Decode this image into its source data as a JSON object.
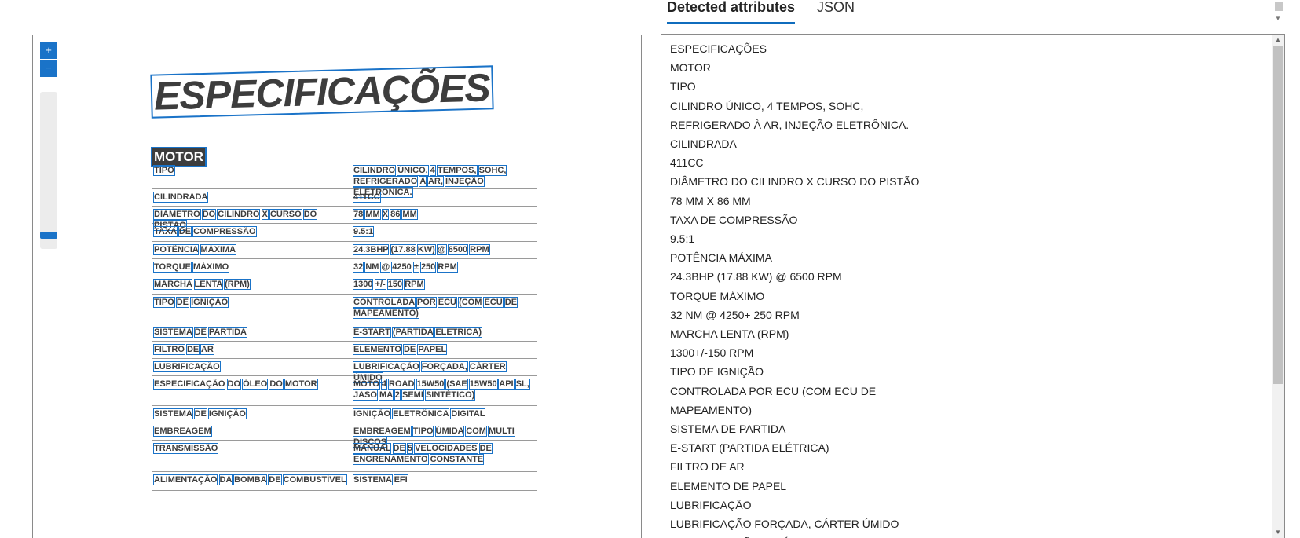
{
  "tabs": [
    {
      "label": "Detected attributes",
      "active": true
    },
    {
      "label": "JSON",
      "active": false
    }
  ],
  "viewer": {
    "zoom_in_icon": "plus-icon",
    "zoom_out_icon": "minus-icon",
    "zoom_in_label": "+",
    "zoom_out_label": "−"
  },
  "document": {
    "title": "ESPECIFICAÇÕES",
    "section": "MOTOR",
    "rows": [
      {
        "label": "TIPO",
        "value": "CILINDRO ÚNICO, 4 TEMPOS, SOHC, REFRIGERADO À AR, INJEÇÃO ELETRÔNICA."
      },
      {
        "label": "CILINDRADA",
        "value": "411CC"
      },
      {
        "label": "DIÂMETRO DO CILINDRO X CURSO DO PISTÃO",
        "value": "78 MM X 86 MM"
      },
      {
        "label": "TAXA DE COMPRESSÃO",
        "value": "9.5:1"
      },
      {
        "label": "POTÊNCIA MÁXIMA",
        "value": "24.3BHP (17.88 KW) @ 6500 RPM"
      },
      {
        "label": "TORQUE MÁXIMO",
        "value": "32 NM @ 4250 ± 250 RPM"
      },
      {
        "label": "MARCHA LENTA (RPM)",
        "value": "1300 +/- 150 RPM"
      },
      {
        "label": "TIPO DE IGNIÇÃO",
        "value": "CONTROLADA POR ECU (COM ECU DE MAPEAMENTO)"
      },
      {
        "label": "SISTEMA DE PARTIDA",
        "value": "E-START (PARTIDA ELÉTRICA)"
      },
      {
        "label": "FILTRO DE AR",
        "value": "ELEMENTO DE PAPEL"
      },
      {
        "label": "LUBRIFICAÇÃO",
        "value": "LUBRIFICAÇÃO FORÇADA, CÁRTER ÚMIDO"
      },
      {
        "label": "ESPECIFICAÇÃO DO ÓLEO DO MOTOR",
        "value": "MOTO 4 ROAD 15W50 (SAE 15W50 API SL, JASO MA 2 SEMI SINTÉTICO)"
      },
      {
        "label": "SISTEMA DE IGNIÇÃO",
        "value": "IGNIÇÃO ELETRÔNICA DIGITAL"
      },
      {
        "label": "EMBREAGEM",
        "value": "EMBREAGEM TIPO ÚMIDA COM MULTI DISCOS"
      },
      {
        "label": "TRANSMISSÃO",
        "value": "MANUAL DE 5 VELOCIDADES DE ENGRENAMENTO CONSTANTE"
      },
      {
        "label": "ALIMENTAÇÃO DA BOMBA DE COMBUSTÍVEL",
        "value": "SISTEMA EFI"
      }
    ]
  },
  "detected_lines": [
    "ESPECIFICAÇÕES",
    "MOTOR",
    "TIPO",
    "CILINDRO ÚNICO, 4 TEMPOS, SOHC,",
    "REFRIGERADO À AR, INJEÇÃO ELETRÔNICA.",
    "CILINDRADA",
    "411CC",
    "DIÂMETRO DO CILINDRO X CURSO DO PISTÃO",
    "78 MM X 86 MM",
    "TAXA DE COMPRESSÃO",
    "9.5:1",
    "POTÊNCIA MÁXIMA",
    "24.3BHP (17.88 KW) @ 6500 RPM",
    "TORQUE MÁXIMO",
    "32 NM @ 4250+ 250 RPM",
    "MARCHA LENTA (RPM)",
    "1300+/-150 RPM",
    "TIPO DE IGNIÇÃO",
    "CONTROLADA POR ECU (COM ECU DE",
    "MAPEAMENTO)",
    "SISTEMA DE PARTIDA",
    "E-START (PARTIDA ELÉTRICA)",
    "FILTRO DE AR",
    "ELEMENTO DE PAPEL",
    "LUBRIFICAÇÃO",
    "LUBRIFICAÇÃO FORÇADA, CÁRTER ÚMIDO",
    "ESPECIFICAÇÃO DO ÓLEO DO MOTOR"
  ],
  "colors": {
    "accent": "#1a73c8",
    "doc_text": "#3d3d3d"
  }
}
